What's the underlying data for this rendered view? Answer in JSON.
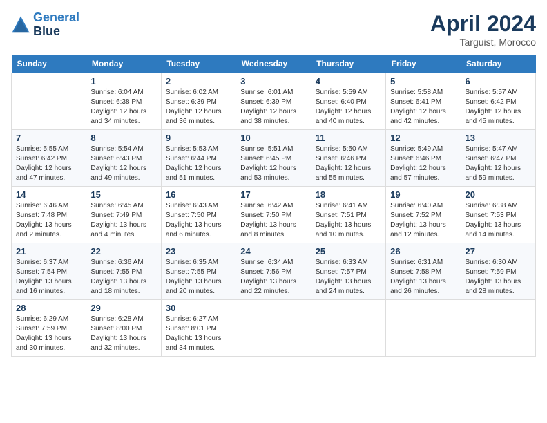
{
  "header": {
    "logo_line1": "General",
    "logo_line2": "Blue",
    "month": "April 2024",
    "location": "Targuist, Morocco"
  },
  "days_of_week": [
    "Sunday",
    "Monday",
    "Tuesday",
    "Wednesday",
    "Thursday",
    "Friday",
    "Saturday"
  ],
  "weeks": [
    [
      {
        "day": "",
        "info": ""
      },
      {
        "day": "1",
        "info": "Sunrise: 6:04 AM\nSunset: 6:38 PM\nDaylight: 12 hours\nand 34 minutes."
      },
      {
        "day": "2",
        "info": "Sunrise: 6:02 AM\nSunset: 6:39 PM\nDaylight: 12 hours\nand 36 minutes."
      },
      {
        "day": "3",
        "info": "Sunrise: 6:01 AM\nSunset: 6:39 PM\nDaylight: 12 hours\nand 38 minutes."
      },
      {
        "day": "4",
        "info": "Sunrise: 5:59 AM\nSunset: 6:40 PM\nDaylight: 12 hours\nand 40 minutes."
      },
      {
        "day": "5",
        "info": "Sunrise: 5:58 AM\nSunset: 6:41 PM\nDaylight: 12 hours\nand 42 minutes."
      },
      {
        "day": "6",
        "info": "Sunrise: 5:57 AM\nSunset: 6:42 PM\nDaylight: 12 hours\nand 45 minutes."
      }
    ],
    [
      {
        "day": "7",
        "info": "Sunrise: 5:55 AM\nSunset: 6:42 PM\nDaylight: 12 hours\nand 47 minutes."
      },
      {
        "day": "8",
        "info": "Sunrise: 5:54 AM\nSunset: 6:43 PM\nDaylight: 12 hours\nand 49 minutes."
      },
      {
        "day": "9",
        "info": "Sunrise: 5:53 AM\nSunset: 6:44 PM\nDaylight: 12 hours\nand 51 minutes."
      },
      {
        "day": "10",
        "info": "Sunrise: 5:51 AM\nSunset: 6:45 PM\nDaylight: 12 hours\nand 53 minutes."
      },
      {
        "day": "11",
        "info": "Sunrise: 5:50 AM\nSunset: 6:46 PM\nDaylight: 12 hours\nand 55 minutes."
      },
      {
        "day": "12",
        "info": "Sunrise: 5:49 AM\nSunset: 6:46 PM\nDaylight: 12 hours\nand 57 minutes."
      },
      {
        "day": "13",
        "info": "Sunrise: 5:47 AM\nSunset: 6:47 PM\nDaylight: 12 hours\nand 59 minutes."
      }
    ],
    [
      {
        "day": "14",
        "info": "Sunrise: 6:46 AM\nSunset: 7:48 PM\nDaylight: 13 hours\nand 2 minutes."
      },
      {
        "day": "15",
        "info": "Sunrise: 6:45 AM\nSunset: 7:49 PM\nDaylight: 13 hours\nand 4 minutes."
      },
      {
        "day": "16",
        "info": "Sunrise: 6:43 AM\nSunset: 7:50 PM\nDaylight: 13 hours\nand 6 minutes."
      },
      {
        "day": "17",
        "info": "Sunrise: 6:42 AM\nSunset: 7:50 PM\nDaylight: 13 hours\nand 8 minutes."
      },
      {
        "day": "18",
        "info": "Sunrise: 6:41 AM\nSunset: 7:51 PM\nDaylight: 13 hours\nand 10 minutes."
      },
      {
        "day": "19",
        "info": "Sunrise: 6:40 AM\nSunset: 7:52 PM\nDaylight: 13 hours\nand 12 minutes."
      },
      {
        "day": "20",
        "info": "Sunrise: 6:38 AM\nSunset: 7:53 PM\nDaylight: 13 hours\nand 14 minutes."
      }
    ],
    [
      {
        "day": "21",
        "info": "Sunrise: 6:37 AM\nSunset: 7:54 PM\nDaylight: 13 hours\nand 16 minutes."
      },
      {
        "day": "22",
        "info": "Sunrise: 6:36 AM\nSunset: 7:55 PM\nDaylight: 13 hours\nand 18 minutes."
      },
      {
        "day": "23",
        "info": "Sunrise: 6:35 AM\nSunset: 7:55 PM\nDaylight: 13 hours\nand 20 minutes."
      },
      {
        "day": "24",
        "info": "Sunrise: 6:34 AM\nSunset: 7:56 PM\nDaylight: 13 hours\nand 22 minutes."
      },
      {
        "day": "25",
        "info": "Sunrise: 6:33 AM\nSunset: 7:57 PM\nDaylight: 13 hours\nand 24 minutes."
      },
      {
        "day": "26",
        "info": "Sunrise: 6:31 AM\nSunset: 7:58 PM\nDaylight: 13 hours\nand 26 minutes."
      },
      {
        "day": "27",
        "info": "Sunrise: 6:30 AM\nSunset: 7:59 PM\nDaylight: 13 hours\nand 28 minutes."
      }
    ],
    [
      {
        "day": "28",
        "info": "Sunrise: 6:29 AM\nSunset: 7:59 PM\nDaylight: 13 hours\nand 30 minutes."
      },
      {
        "day": "29",
        "info": "Sunrise: 6:28 AM\nSunset: 8:00 PM\nDaylight: 13 hours\nand 32 minutes."
      },
      {
        "day": "30",
        "info": "Sunrise: 6:27 AM\nSunset: 8:01 PM\nDaylight: 13 hours\nand 34 minutes."
      },
      {
        "day": "",
        "info": ""
      },
      {
        "day": "",
        "info": ""
      },
      {
        "day": "",
        "info": ""
      },
      {
        "day": "",
        "info": ""
      }
    ]
  ]
}
